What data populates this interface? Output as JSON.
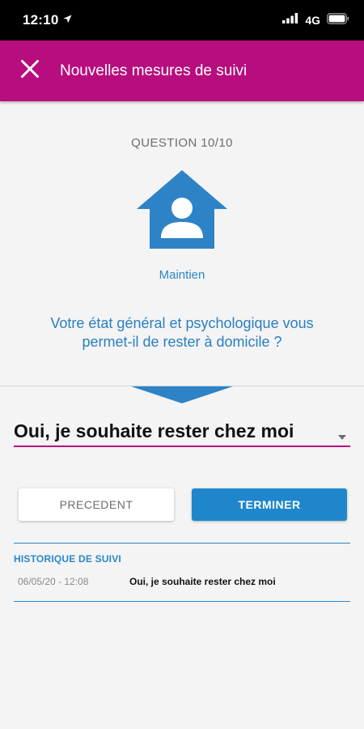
{
  "status_bar": {
    "time": "12:10",
    "network": "4G"
  },
  "app_bar": {
    "title": "Nouvelles mesures de suivi",
    "close_icon": "close-icon"
  },
  "question": {
    "counter": "QUESTION 10/10",
    "category": "Maintien",
    "category_icon": "house-person-icon",
    "text": "Votre état général et psychologique vous permet-il de rester à domicile ?"
  },
  "answer_select": {
    "selected": "Oui, je souhaite rester chez moi"
  },
  "buttons": {
    "previous": "PRECEDENT",
    "finish": "TERMINER"
  },
  "history": {
    "title": "HISTORIQUE DE SUIVI",
    "entries": [
      {
        "datetime": "06/05/20 - 12:08",
        "answer": "Oui, je souhaite rester chez moi"
      }
    ]
  },
  "colors": {
    "brand_magenta": "#b70d7e",
    "accent_blue": "#2a87c8",
    "button_blue": "#1f86cc"
  }
}
